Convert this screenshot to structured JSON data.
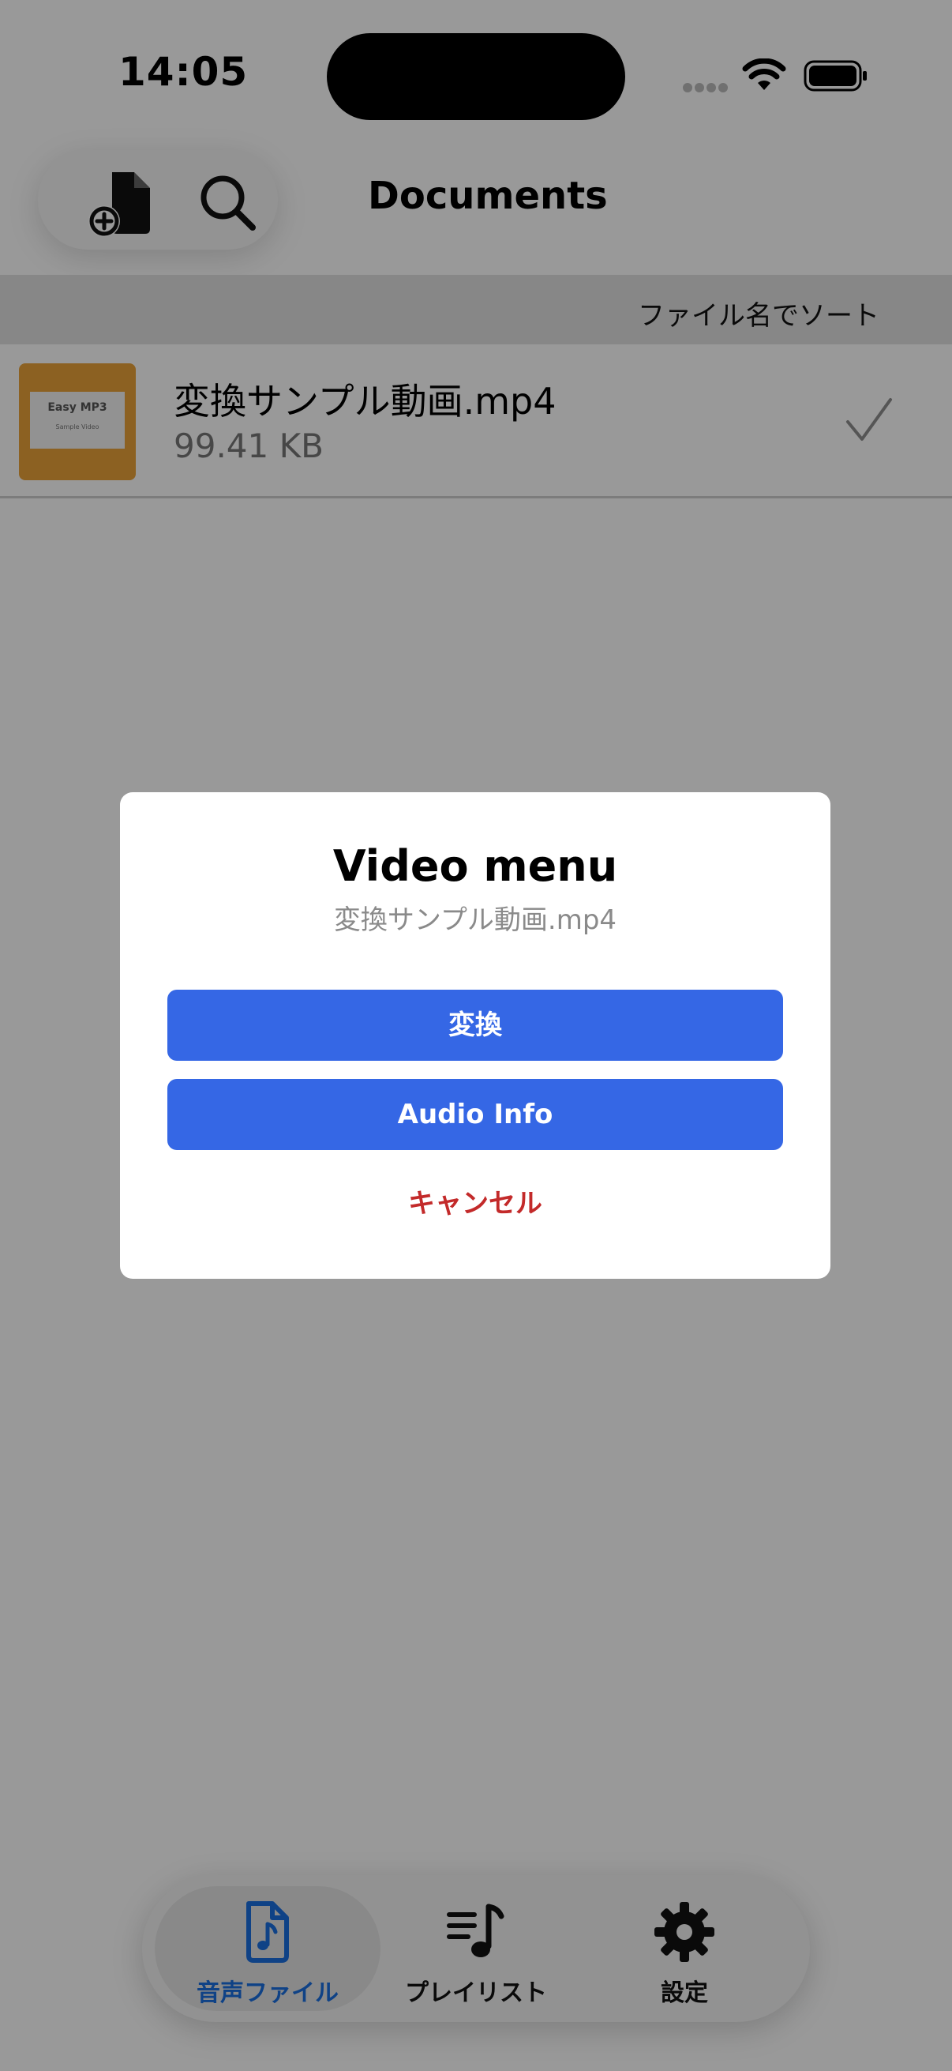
{
  "status_bar": {
    "time": "14:05"
  },
  "header": {
    "title": "Documents",
    "add_file_icon": "document-plus-icon",
    "search_icon": "magnifier-icon"
  },
  "sort": {
    "label": "ファイル名でソート"
  },
  "files": [
    {
      "name": "変換サンプル動画.mp4",
      "size": "99.41 KB",
      "thumbnail_title": "Easy MP3",
      "thumbnail_subtitle": "Sample Video",
      "selected": true
    }
  ],
  "dialog": {
    "title": "Video menu",
    "subtitle": "変換サンプル動画.mp4",
    "convert_label": "変換",
    "audio_info_label": "Audio Info",
    "cancel_label": "キャンセル"
  },
  "tabs": [
    {
      "label": "音声ファイル",
      "icon": "music-file-icon",
      "active": true
    },
    {
      "label": "プレイリスト",
      "icon": "playlist-icon",
      "active": false
    },
    {
      "label": "設定",
      "icon": "gear-icon",
      "active": false
    }
  ],
  "colors": {
    "accent_blue": "#3567e5",
    "tab_active_blue": "#1a6ee0",
    "cancel_red": "#c32a2a",
    "thumbnail_orange": "#e9a23a"
  }
}
